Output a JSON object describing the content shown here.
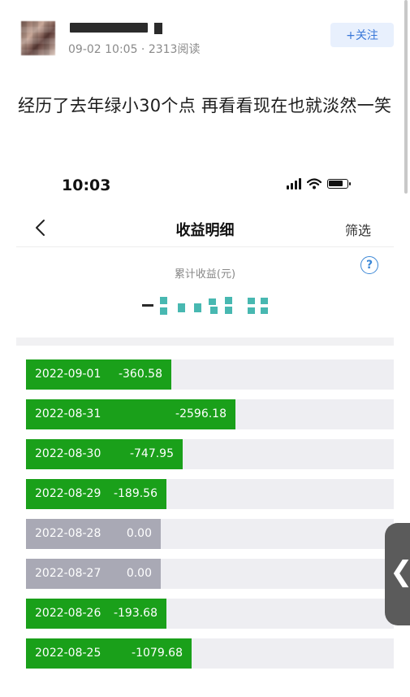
{
  "post": {
    "meta": "09-02 10:05 · 2313阅读",
    "follow_label": "+关注",
    "text": "经历了去年绿小30个点 再看看现在也就淡然一笑"
  },
  "screenshot": {
    "status_time": "10:03",
    "nav_title": "收益明细",
    "filter_label": "筛选",
    "summary_label": "累计收益(元)",
    "help_glyph": "?",
    "colors": {
      "gain_bar": "#1aa01a",
      "zero_bar": "#a9a9b5",
      "track": "#eeeef2",
      "accent": "#3b87d6"
    }
  },
  "chart_data": {
    "type": "bar",
    "categories": [
      "2022-09-01",
      "2022-08-31",
      "2022-08-30",
      "2022-08-29",
      "2022-08-28",
      "2022-08-27",
      "2022-08-26",
      "2022-08-25"
    ],
    "values": [
      -360.58,
      -2596.18,
      -747.95,
      -189.56,
      0.0,
      0.0,
      -193.68,
      -1079.68
    ],
    "labels": [
      "-360.58",
      "-2596.18",
      "-747.95",
      "-189.56",
      "0.00",
      "0.00",
      "-193.68",
      "-1079.68"
    ]
  },
  "side_tab": {
    "glyph": "❮"
  }
}
